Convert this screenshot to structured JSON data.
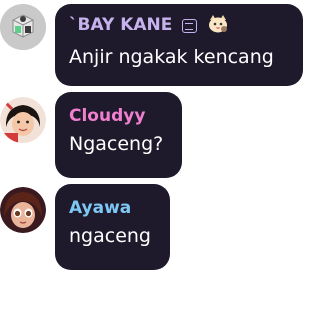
{
  "messages": [
    {
      "username": "`BAY KANE",
      "username_color": "#c6b2ec",
      "text": "Anjir ngakak kencang",
      "avatar": "bot-avatar-icon",
      "badges": [
        "server-tag-icon",
        "cat-emoji-badge-icon"
      ]
    },
    {
      "username": "Cloudyy",
      "username_color": "#f07fd0",
      "text": "Ngaceng?",
      "avatar": "user-avatar-cloudyy"
    },
    {
      "username": "Ayawa",
      "username_color": "#7ec8f5",
      "text": "ngaceng",
      "avatar": "user-avatar-ayawa"
    }
  ],
  "colors": {
    "bubble_bg": "#1e1a2b",
    "message_text": "#ffffff"
  }
}
